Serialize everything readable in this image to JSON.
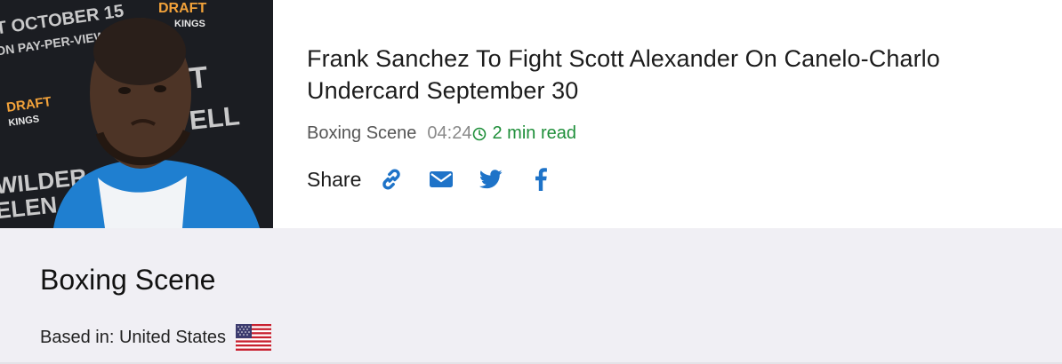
{
  "article": {
    "headline": "Frank Sanchez To Fight Scott Alexander On Canelo-Charlo Undercard September 30",
    "source": "Boxing Scene",
    "time": "04:24",
    "read_time": "2 min read",
    "thumbnail_icon": "boxer-photo",
    "colors": {
      "read_time": "#1f8f3a",
      "share_icons": "#1e73c8",
      "time": "#8a8a8a"
    }
  },
  "share": {
    "label": "Share",
    "icons": [
      "link-icon",
      "mail-icon",
      "twitter-icon",
      "facebook-icon"
    ]
  },
  "source_info": {
    "name": "Boxing Scene",
    "based_in": "Based in: United States",
    "flag_icon": "us-flag-icon"
  }
}
